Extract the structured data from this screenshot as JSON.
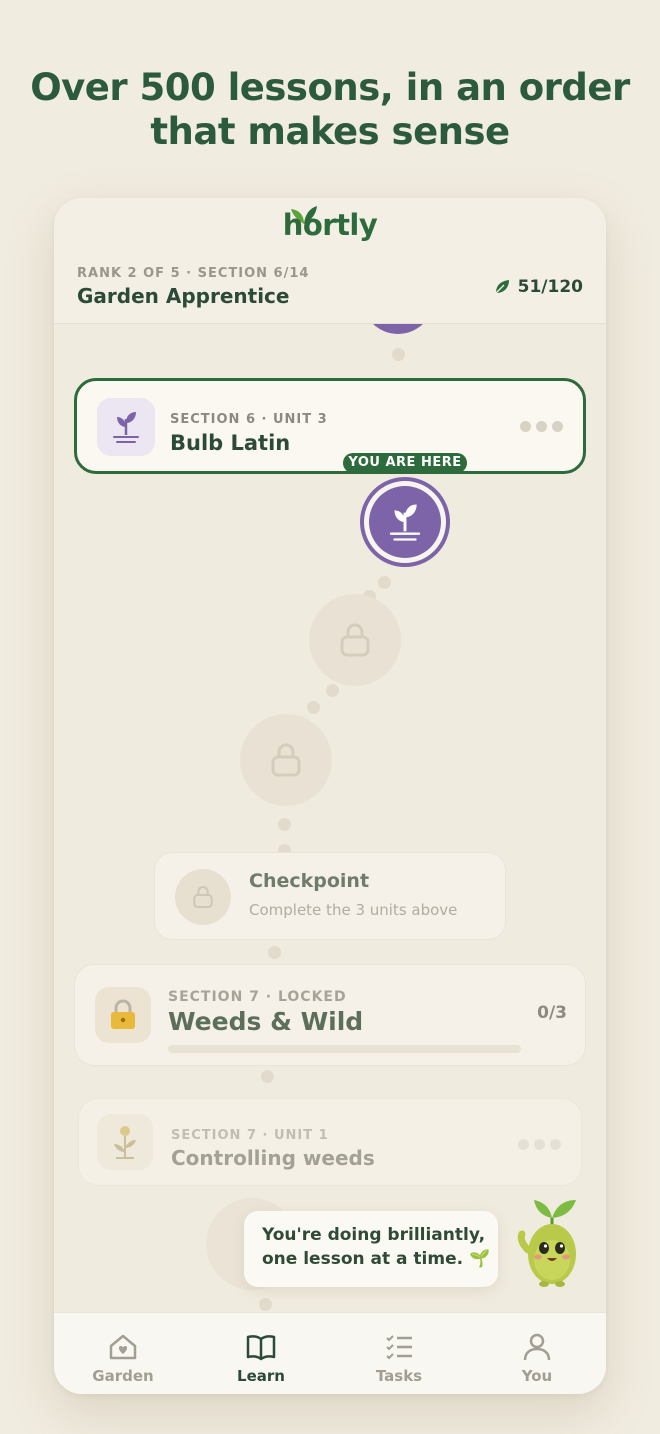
{
  "headline": {
    "line1": "Over 500 lessons, in an order",
    "line2": "that makes sense"
  },
  "app": {
    "logo": "hortly"
  },
  "header": {
    "rank_label": "RANK 2 OF 5 · SECTION 6/14",
    "rank_title": "Garden Apprentice",
    "leaf_count": "51/120"
  },
  "current_unit": {
    "subtitle": "SECTION 6 · UNIT 3",
    "title": "Bulb Latin",
    "badge": "YOU ARE HERE",
    "icon": "sprout-icon"
  },
  "checkpoint": {
    "title": "Checkpoint",
    "subtitle": "Complete the 3 units above"
  },
  "section_card": {
    "subtitle": "SECTION 7 · LOCKED",
    "title": "Weeds & Wild",
    "count": "0/3",
    "progress": 0
  },
  "next_unit": {
    "subtitle": "SECTION 7 · UNIT 1",
    "title": "Controlling weeds",
    "icon": "dandelion-icon"
  },
  "mascot_bubble": {
    "line1": "You're doing brilliantly,",
    "line2": "one lesson at a time. 🌱"
  },
  "tabs": [
    {
      "label": "Garden",
      "icon": "house-heart-icon",
      "active": false
    },
    {
      "label": "Learn",
      "icon": "book-icon",
      "active": true
    },
    {
      "label": "Tasks",
      "icon": "checklist-icon",
      "active": false
    },
    {
      "label": "You",
      "icon": "person-icon",
      "active": false
    }
  ],
  "colors": {
    "brand_green": "#2e6b3c",
    "accent_purple": "#7d63a8",
    "background": "#f1ece0"
  }
}
